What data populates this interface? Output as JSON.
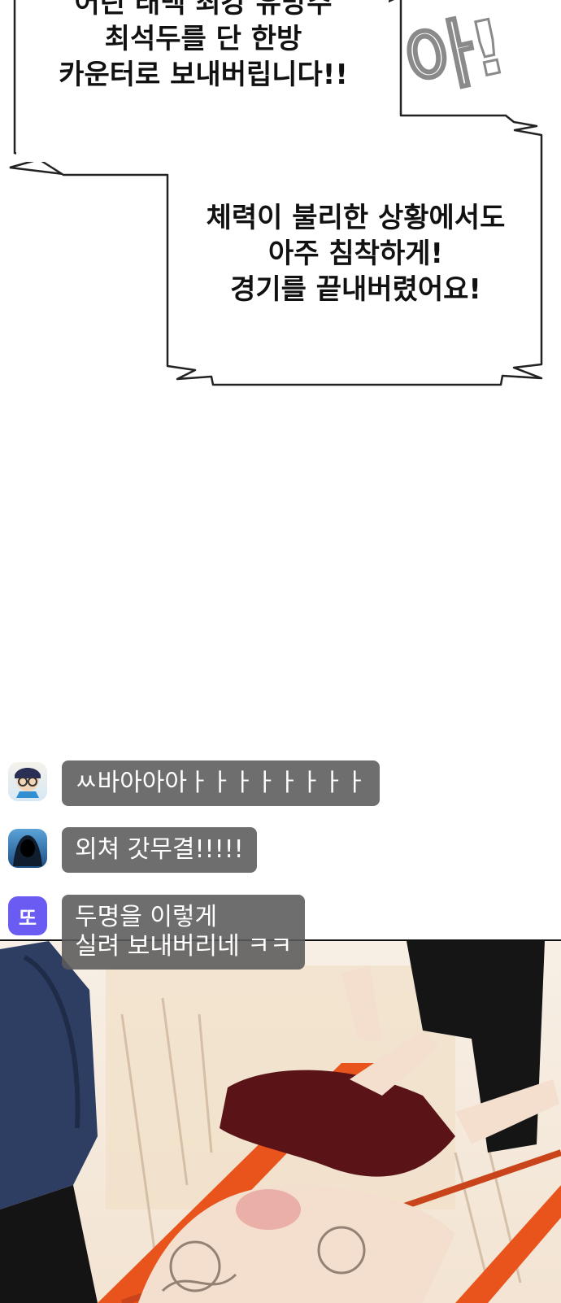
{
  "bubbles": {
    "top": {
      "lines": [
        "어린 태백 최강 유망주",
        "최석두를 단 한방",
        "카운터로 보내버립니다!!"
      ]
    },
    "middle": {
      "lines": [
        "체력이 불리한 상황에서도",
        "아주 침착하게!",
        "경기를 끝내버렸어요!"
      ]
    }
  },
  "sfx": {
    "text": "아!"
  },
  "chat": [
    {
      "avatar": "character-avatar-icon",
      "avatar_text": "",
      "lines": [
        "ㅆ바아아아ㅏㅏㅏㅏㅏㅏㅏㅏ"
      ]
    },
    {
      "avatar": "hooded-figure-avatar-icon",
      "avatar_text": "",
      "lines": [
        "외쳐 갓무결!!!!!"
      ]
    },
    {
      "avatar": "letter-avatar",
      "avatar_text": "또",
      "lines": [
        "두명을 이렇게",
        "실려 보내버리네 ㅋㅋ"
      ]
    }
  ],
  "colors": {
    "chat_bubble": "#5a5a5a",
    "avatar_purple": "#6a5bf3",
    "stretcher_orange": "#e8541c",
    "shorts_maroon": "#5a1418"
  }
}
